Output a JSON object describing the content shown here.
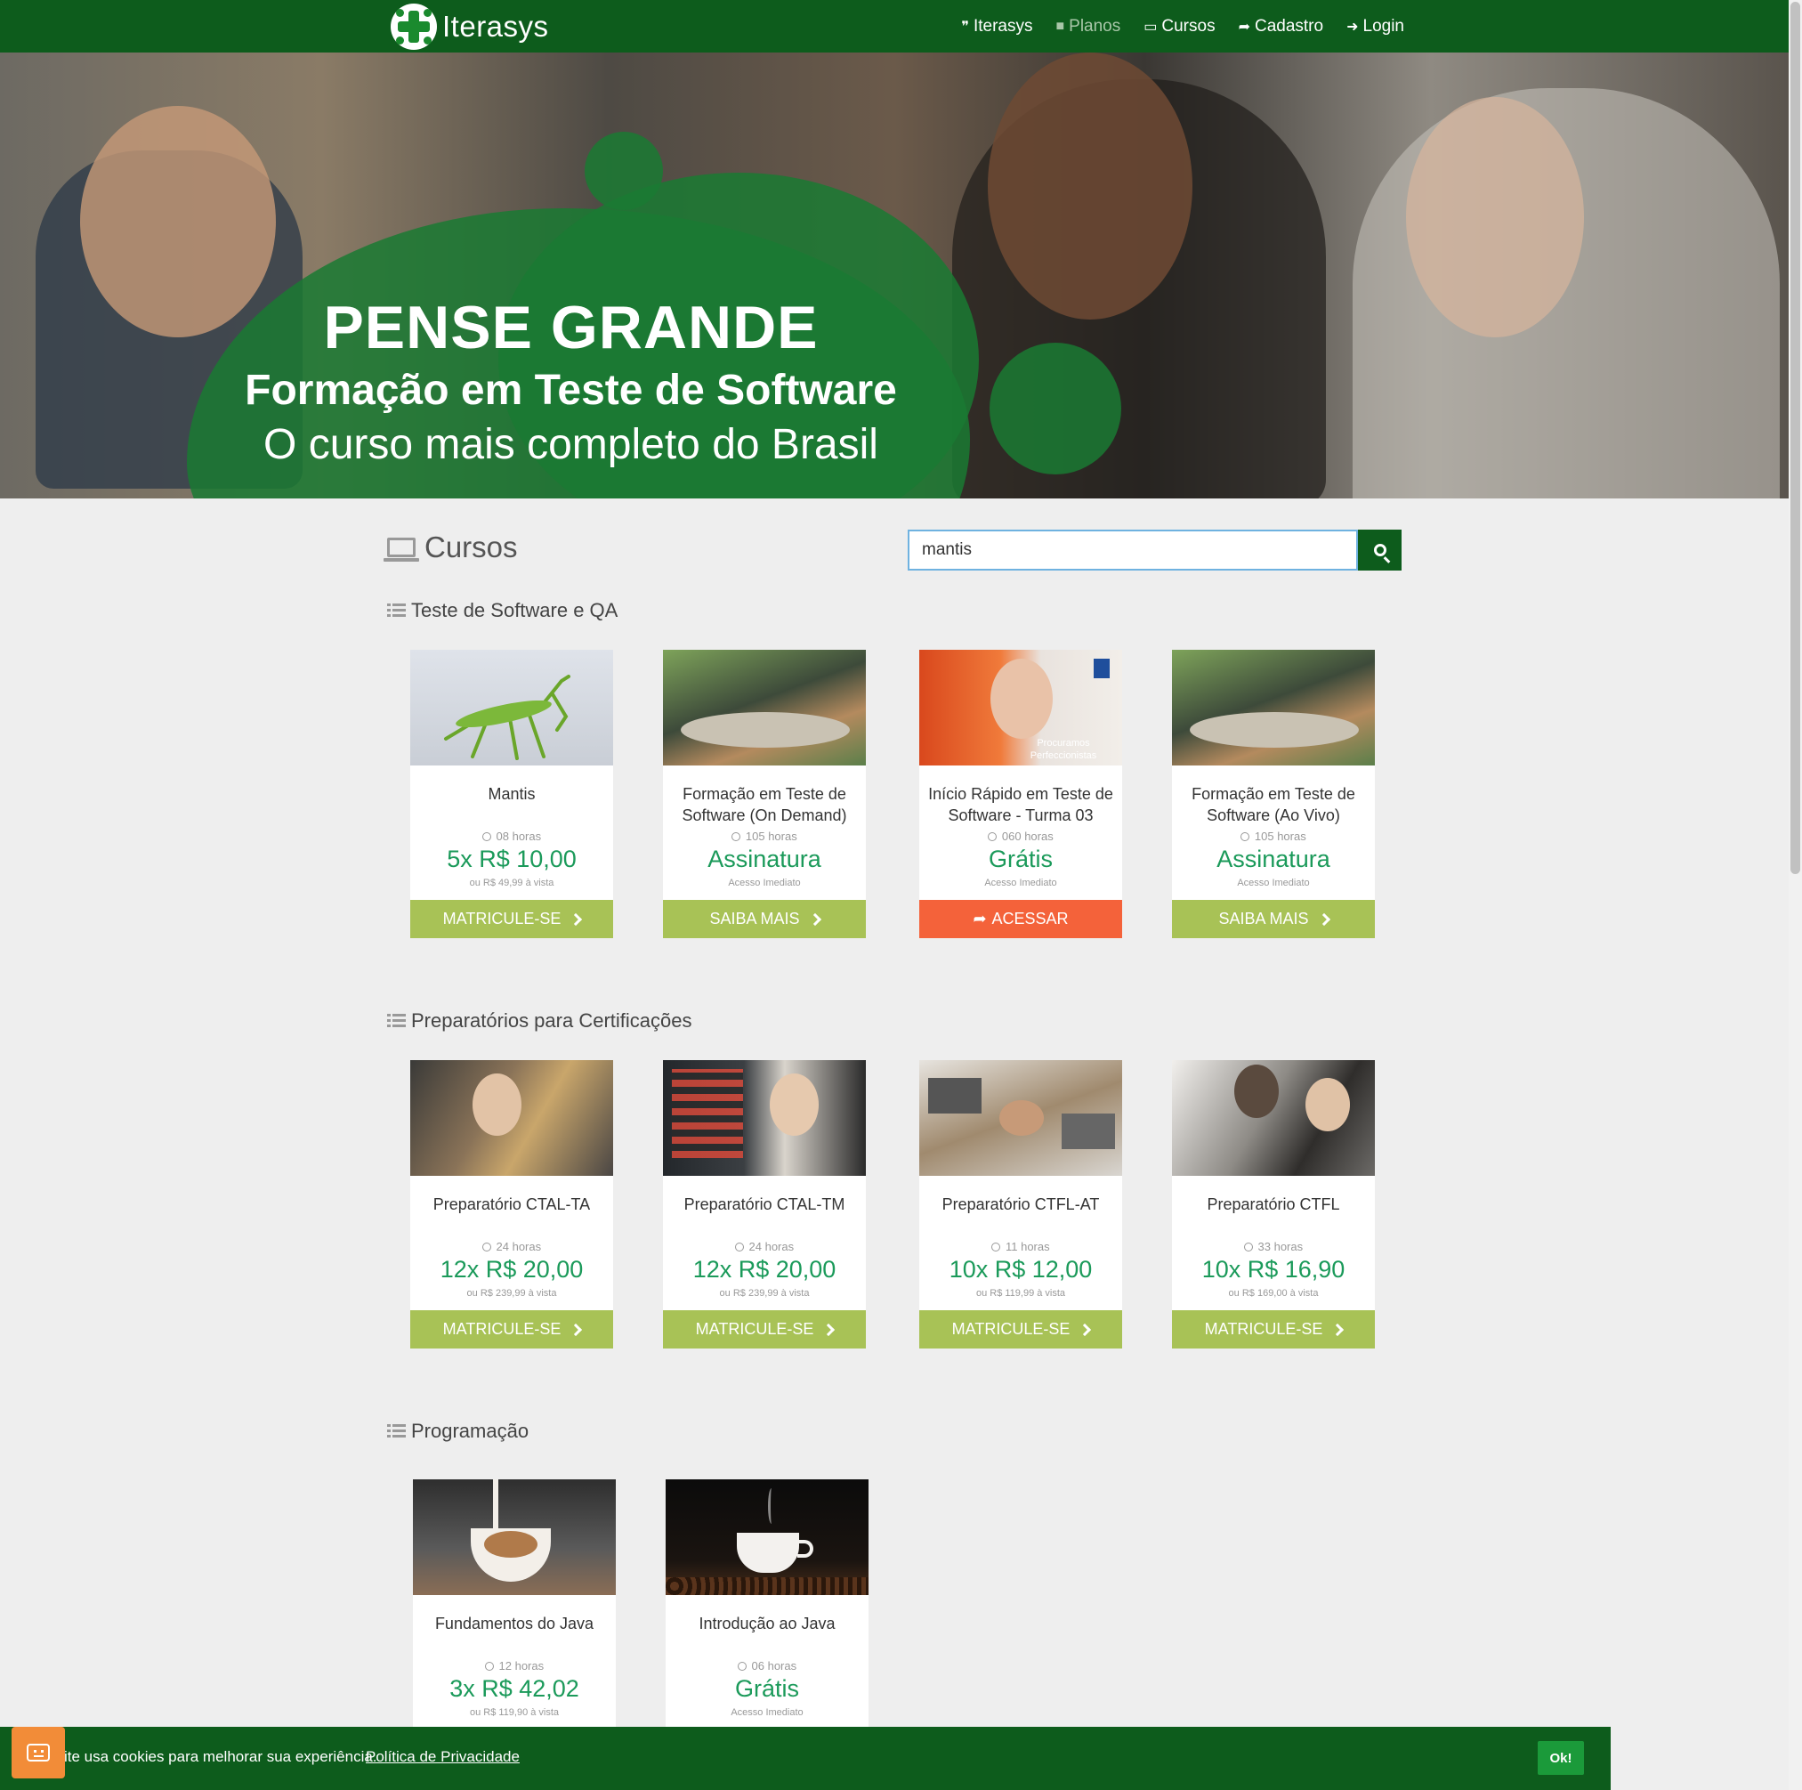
{
  "navbar": {
    "brand": "Iterasys",
    "items": [
      {
        "label": "Iterasys",
        "icon": "quote-icon",
        "muted": false
      },
      {
        "label": "Planos",
        "icon": "bookmark-icon",
        "muted": true
      },
      {
        "label": "Cursos",
        "icon": "laptop-icon",
        "muted": false
      },
      {
        "label": "Cadastro",
        "icon": "share-icon",
        "muted": false
      },
      {
        "label": "Login",
        "icon": "sign-in-icon",
        "muted": false
      }
    ]
  },
  "hero": {
    "title": "PENSE GRANDE",
    "subtitle": "Formação em Teste de Software",
    "tagline": "O curso mais completo do Brasil"
  },
  "courses_header": {
    "title": "Cursos",
    "search_value": "mantis"
  },
  "sections": [
    {
      "title": "Teste de Software e QA",
      "cards": [
        {
          "name": "Mantis",
          "hours": "08 horas",
          "price": "5x R$ 10,00",
          "note": "ou R$ 49,99 à vista",
          "button": "MATRICULE-SE"
        },
        {
          "name": "Formação em Teste de Software (On Demand)",
          "hours": "105 horas",
          "price": "Assinatura",
          "note": "Acesso Imediato",
          "button": "SAIBA MAIS"
        },
        {
          "name": "Início Rápido em Teste de Software - Turma 03",
          "hours": "060 horas",
          "price": "Grátis",
          "note": "Acesso Imediato",
          "button": "ACESSAR",
          "image_caption": "Procuramos Perfeccionistas"
        },
        {
          "name": "Formação em Teste de Software (Ao Vivo)",
          "hours": "105 horas",
          "price": "Assinatura",
          "note": "Acesso Imediato",
          "button": "SAIBA MAIS"
        }
      ]
    },
    {
      "title": "Preparatórios para Certificações",
      "cards": [
        {
          "name": "Preparatório CTAL-TA",
          "hours": "24 horas",
          "price": "12x R$ 20,00",
          "note": "ou R$ 239,99 à vista",
          "button": "MATRICULE-SE"
        },
        {
          "name": "Preparatório CTAL-TM",
          "hours": "24 horas",
          "price": "12x R$ 20,00",
          "note": "ou R$ 239,99 à vista",
          "button": "MATRICULE-SE"
        },
        {
          "name": "Preparatório CTFL-AT",
          "hours": "11 horas",
          "price": "10x R$ 12,00",
          "note": "ou R$ 119,99 à vista",
          "button": "MATRICULE-SE"
        },
        {
          "name": "Preparatório CTFL",
          "hours": "33 horas",
          "price": "10x R$ 16,90",
          "note": "ou R$ 169,00 à vista",
          "button": "MATRICULE-SE"
        }
      ]
    },
    {
      "title": "Programação",
      "cards": [
        {
          "name": "Fundamentos do Java",
          "hours": "12 horas",
          "price": "3x R$ 42,02",
          "note": "ou R$ 119,90 à vista"
        },
        {
          "name": "Introdução ao Java",
          "hours": "06 horas",
          "price": "Grátis",
          "note": "Acesso Imediato"
        }
      ]
    }
  ],
  "cookie_bar": {
    "text": "ite usa cookies para melhorar sua experiência.",
    "link": "Política de Privacidade",
    "ok": "Ok!"
  },
  "colors": {
    "brand_green": "#0d5c1c",
    "price_green": "#1b9a5a",
    "button_olive": "#a8c256",
    "button_orange": "#f4623a",
    "chat_orange": "#f28c38"
  }
}
